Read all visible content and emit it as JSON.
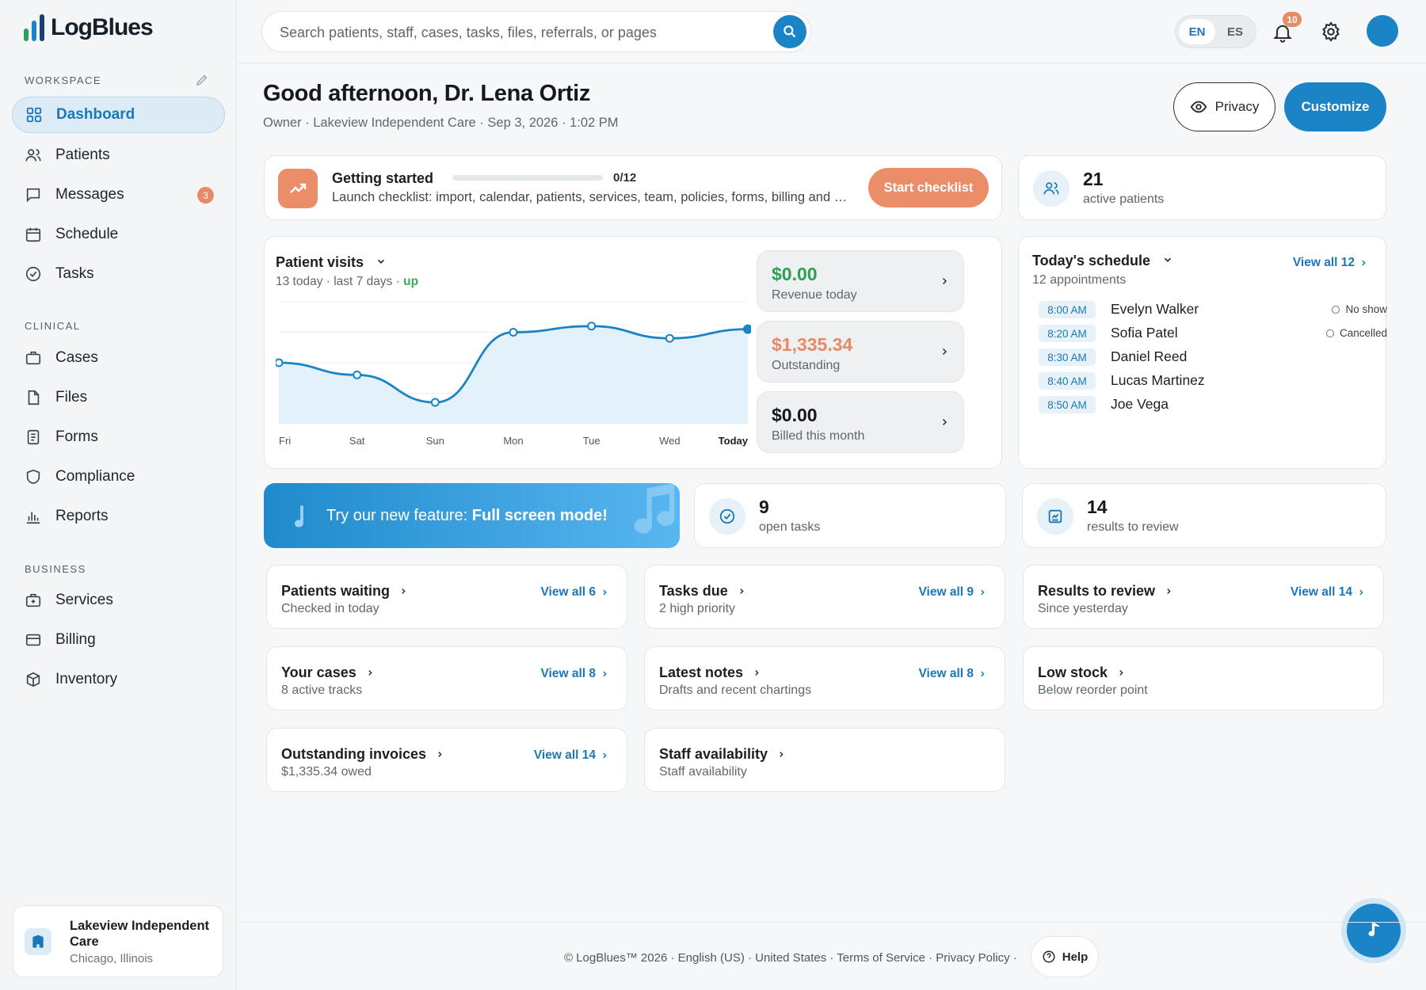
{
  "app": {
    "name": "LogBlues"
  },
  "sidebar": {
    "workspace_title": "WORKSPACE",
    "clinical_title": "CLINICAL",
    "business_title": "BUSINESS",
    "items": [
      {
        "label": "Dashboard",
        "icon": "grid-icon"
      },
      {
        "label": "Patients",
        "icon": "users-icon"
      },
      {
        "label": "Messages",
        "icon": "message-icon",
        "badge": "3"
      },
      {
        "label": "Schedule",
        "icon": "calendar-icon"
      },
      {
        "label": "Tasks",
        "icon": "check-circle-icon"
      },
      {
        "label": "Cases",
        "icon": "briefcase-icon"
      },
      {
        "label": "Files",
        "icon": "file-icon"
      },
      {
        "label": "Forms",
        "icon": "form-icon"
      },
      {
        "label": "Compliance",
        "icon": "shield-icon"
      },
      {
        "label": "Reports",
        "icon": "bar-chart-icon"
      },
      {
        "label": "Services",
        "icon": "medical-bag-icon"
      },
      {
        "label": "Billing",
        "icon": "credit-card-icon"
      },
      {
        "label": "Inventory",
        "icon": "box-icon"
      }
    ],
    "org": {
      "name": "Lakeview Independent Care",
      "location": "Chicago, Illinois"
    }
  },
  "topbar": {
    "search_placeholder": "Search patients, staff, cases, tasks, files, referrals, or pages",
    "lang_en": "EN",
    "lang_es": "ES",
    "notifications": "10"
  },
  "header": {
    "greeting": "Good afternoon, Dr. Lena Ortiz",
    "subtitle": "Owner · Lakeview Independent Care · Sep 3, 2026 · 1:02 PM",
    "privacy_label": "Privacy",
    "customize_label": "Customize"
  },
  "getting_started": {
    "title": "Getting started",
    "progress": "0/12",
    "progress_fraction": 0,
    "desc": "Launch checklist: import, calendar, patients, services, team, policies, forms, billing and more",
    "button": "Start checklist"
  },
  "active_patients": {
    "value": "21",
    "label": "active patients"
  },
  "patient_visits": {
    "title": "Patient visits",
    "sub_prefix": "13 today · last 7 days · ",
    "sub_trend": "up"
  },
  "chart_data": {
    "type": "area",
    "categories": [
      "Fri",
      "Sat",
      "Sun",
      "Mon",
      "Tue",
      "Wed",
      "Today"
    ],
    "values": [
      10,
      8,
      3.5,
      15,
      16,
      14,
      15.5
    ],
    "ylim": [
      0,
      20
    ],
    "grid": true,
    "color": "#1b84c7"
  },
  "revenue": [
    {
      "value": "$0.00",
      "label": "Revenue today",
      "color": "#2f9e55"
    },
    {
      "value": "$1,335.34",
      "label": "Outstanding",
      "color": "#e98a66"
    },
    {
      "value": "$0.00",
      "label": "Billed this month",
      "color": "#15191e"
    }
  ],
  "schedule": {
    "title": "Today's schedule",
    "sub": "12 appointments",
    "view_all": "View all 12",
    "appointments": [
      {
        "time": "8:00 AM",
        "name": "Evelyn Walker",
        "status": "No show"
      },
      {
        "time": "8:20 AM",
        "name": "Sofia Patel",
        "status": "Cancelled"
      },
      {
        "time": "8:30 AM",
        "name": "Daniel Reed",
        "status": ""
      },
      {
        "time": "8:40 AM",
        "name": "Lucas Martinez",
        "status": ""
      },
      {
        "time": "8:50 AM",
        "name": "Joe Vega",
        "status": ""
      }
    ]
  },
  "promo": {
    "prefix": "Try our new feature: ",
    "bold": "Full screen mode!"
  },
  "open_tasks": {
    "value": "9",
    "label": "open tasks"
  },
  "results": {
    "value": "14",
    "label": "results to review"
  },
  "summary_cards": [
    {
      "title": "Patients waiting",
      "sub": "Checked in today",
      "view_all": "View all 6"
    },
    {
      "title": "Tasks due",
      "sub": "2 high priority",
      "view_all": "View all 9"
    },
    {
      "title": "Results to review",
      "sub": "Since yesterday",
      "view_all": "View all 14"
    },
    {
      "title": "Your cases",
      "sub": "8 active tracks",
      "view_all": "View all 8"
    },
    {
      "title": "Latest notes",
      "sub": "Drafts and recent chartings",
      "view_all": "View all 8"
    },
    {
      "title": "Low stock",
      "sub": "Below reorder point",
      "view_all": ""
    },
    {
      "title": "Outstanding invoices",
      "sub": "$1,335.34 owed",
      "view_all": "View all 14"
    },
    {
      "title": "Staff availability",
      "sub": "Staff availability",
      "view_all": ""
    }
  ],
  "footer": {
    "text": "© LogBlues™ 2026 · English (US) · United States · Terms of Service · Privacy Policy ·",
    "help": "Help"
  }
}
